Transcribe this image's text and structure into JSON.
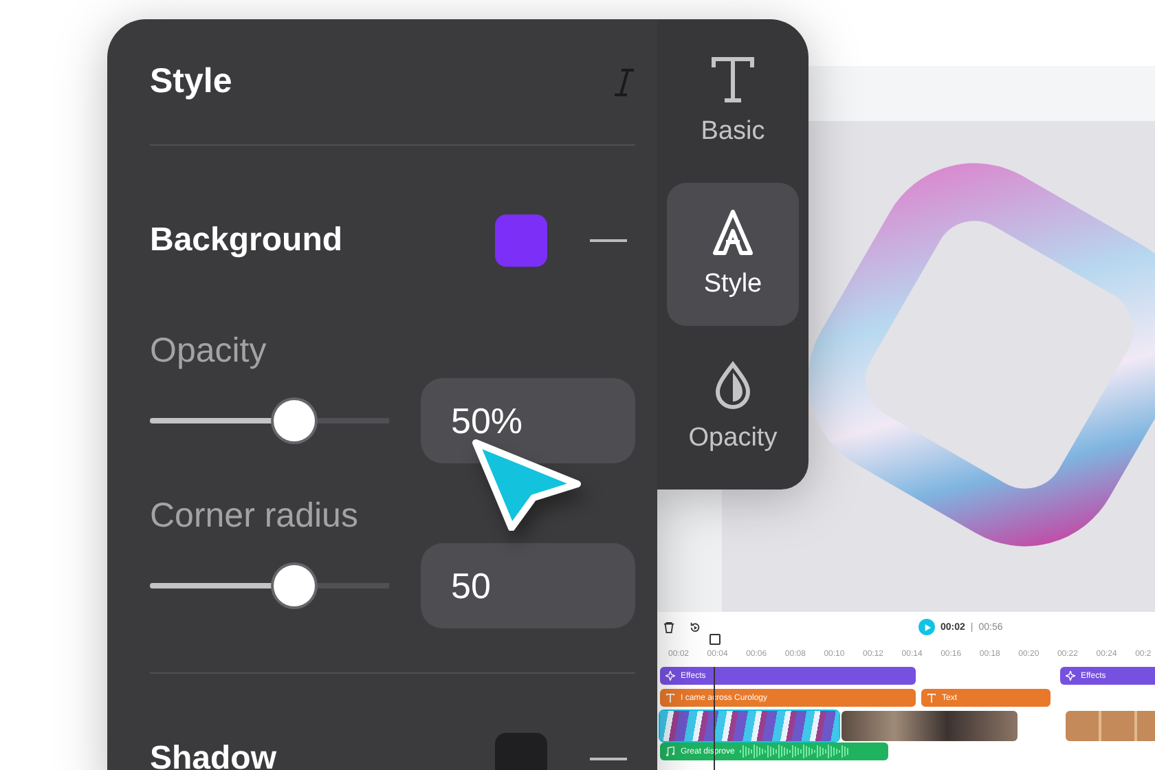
{
  "panel": {
    "title": "Style",
    "background": {
      "label": "Background",
      "color": "#7b2ff7"
    },
    "sliders": [
      {
        "label": "Opacity",
        "level": 0.52,
        "value": "50%"
      },
      {
        "label": "Corner radius",
        "level": 0.52,
        "value": "50"
      }
    ],
    "shadow": {
      "label": "Shadow",
      "color": "#1f1f22"
    }
  },
  "sidebar": {
    "tabs": [
      {
        "label": "Basic",
        "kind": "text",
        "selected": false
      },
      {
        "label": "Style",
        "kind": "style",
        "selected": true
      },
      {
        "label": "Opacity",
        "kind": "opacity",
        "selected": false
      }
    ]
  },
  "timeline": {
    "current_time": "00:02",
    "separator": "|",
    "duration": "00:56",
    "ruler": [
      "00:02",
      "00:04",
      "00:06",
      "00:08",
      "00:10",
      "00:12",
      "00:14",
      "00:16",
      "00:18",
      "00:20",
      "00:22",
      "00:24",
      "00:2"
    ],
    "tracks": [
      {
        "kind": "effect",
        "clips": [
          {
            "label": "Effects"
          },
          {
            "label": "Effects"
          }
        ]
      },
      {
        "kind": "text",
        "clips": [
          {
            "label": "I came across Curology"
          },
          {
            "label": "Text"
          }
        ]
      },
      {
        "kind": "video",
        "clips": [
          {
            "selected": true
          },
          {
            "selected": false
          },
          {
            "selected": false
          }
        ]
      },
      {
        "kind": "audio",
        "clips": [
          {
            "label": "Great  disprove"
          }
        ]
      }
    ]
  }
}
